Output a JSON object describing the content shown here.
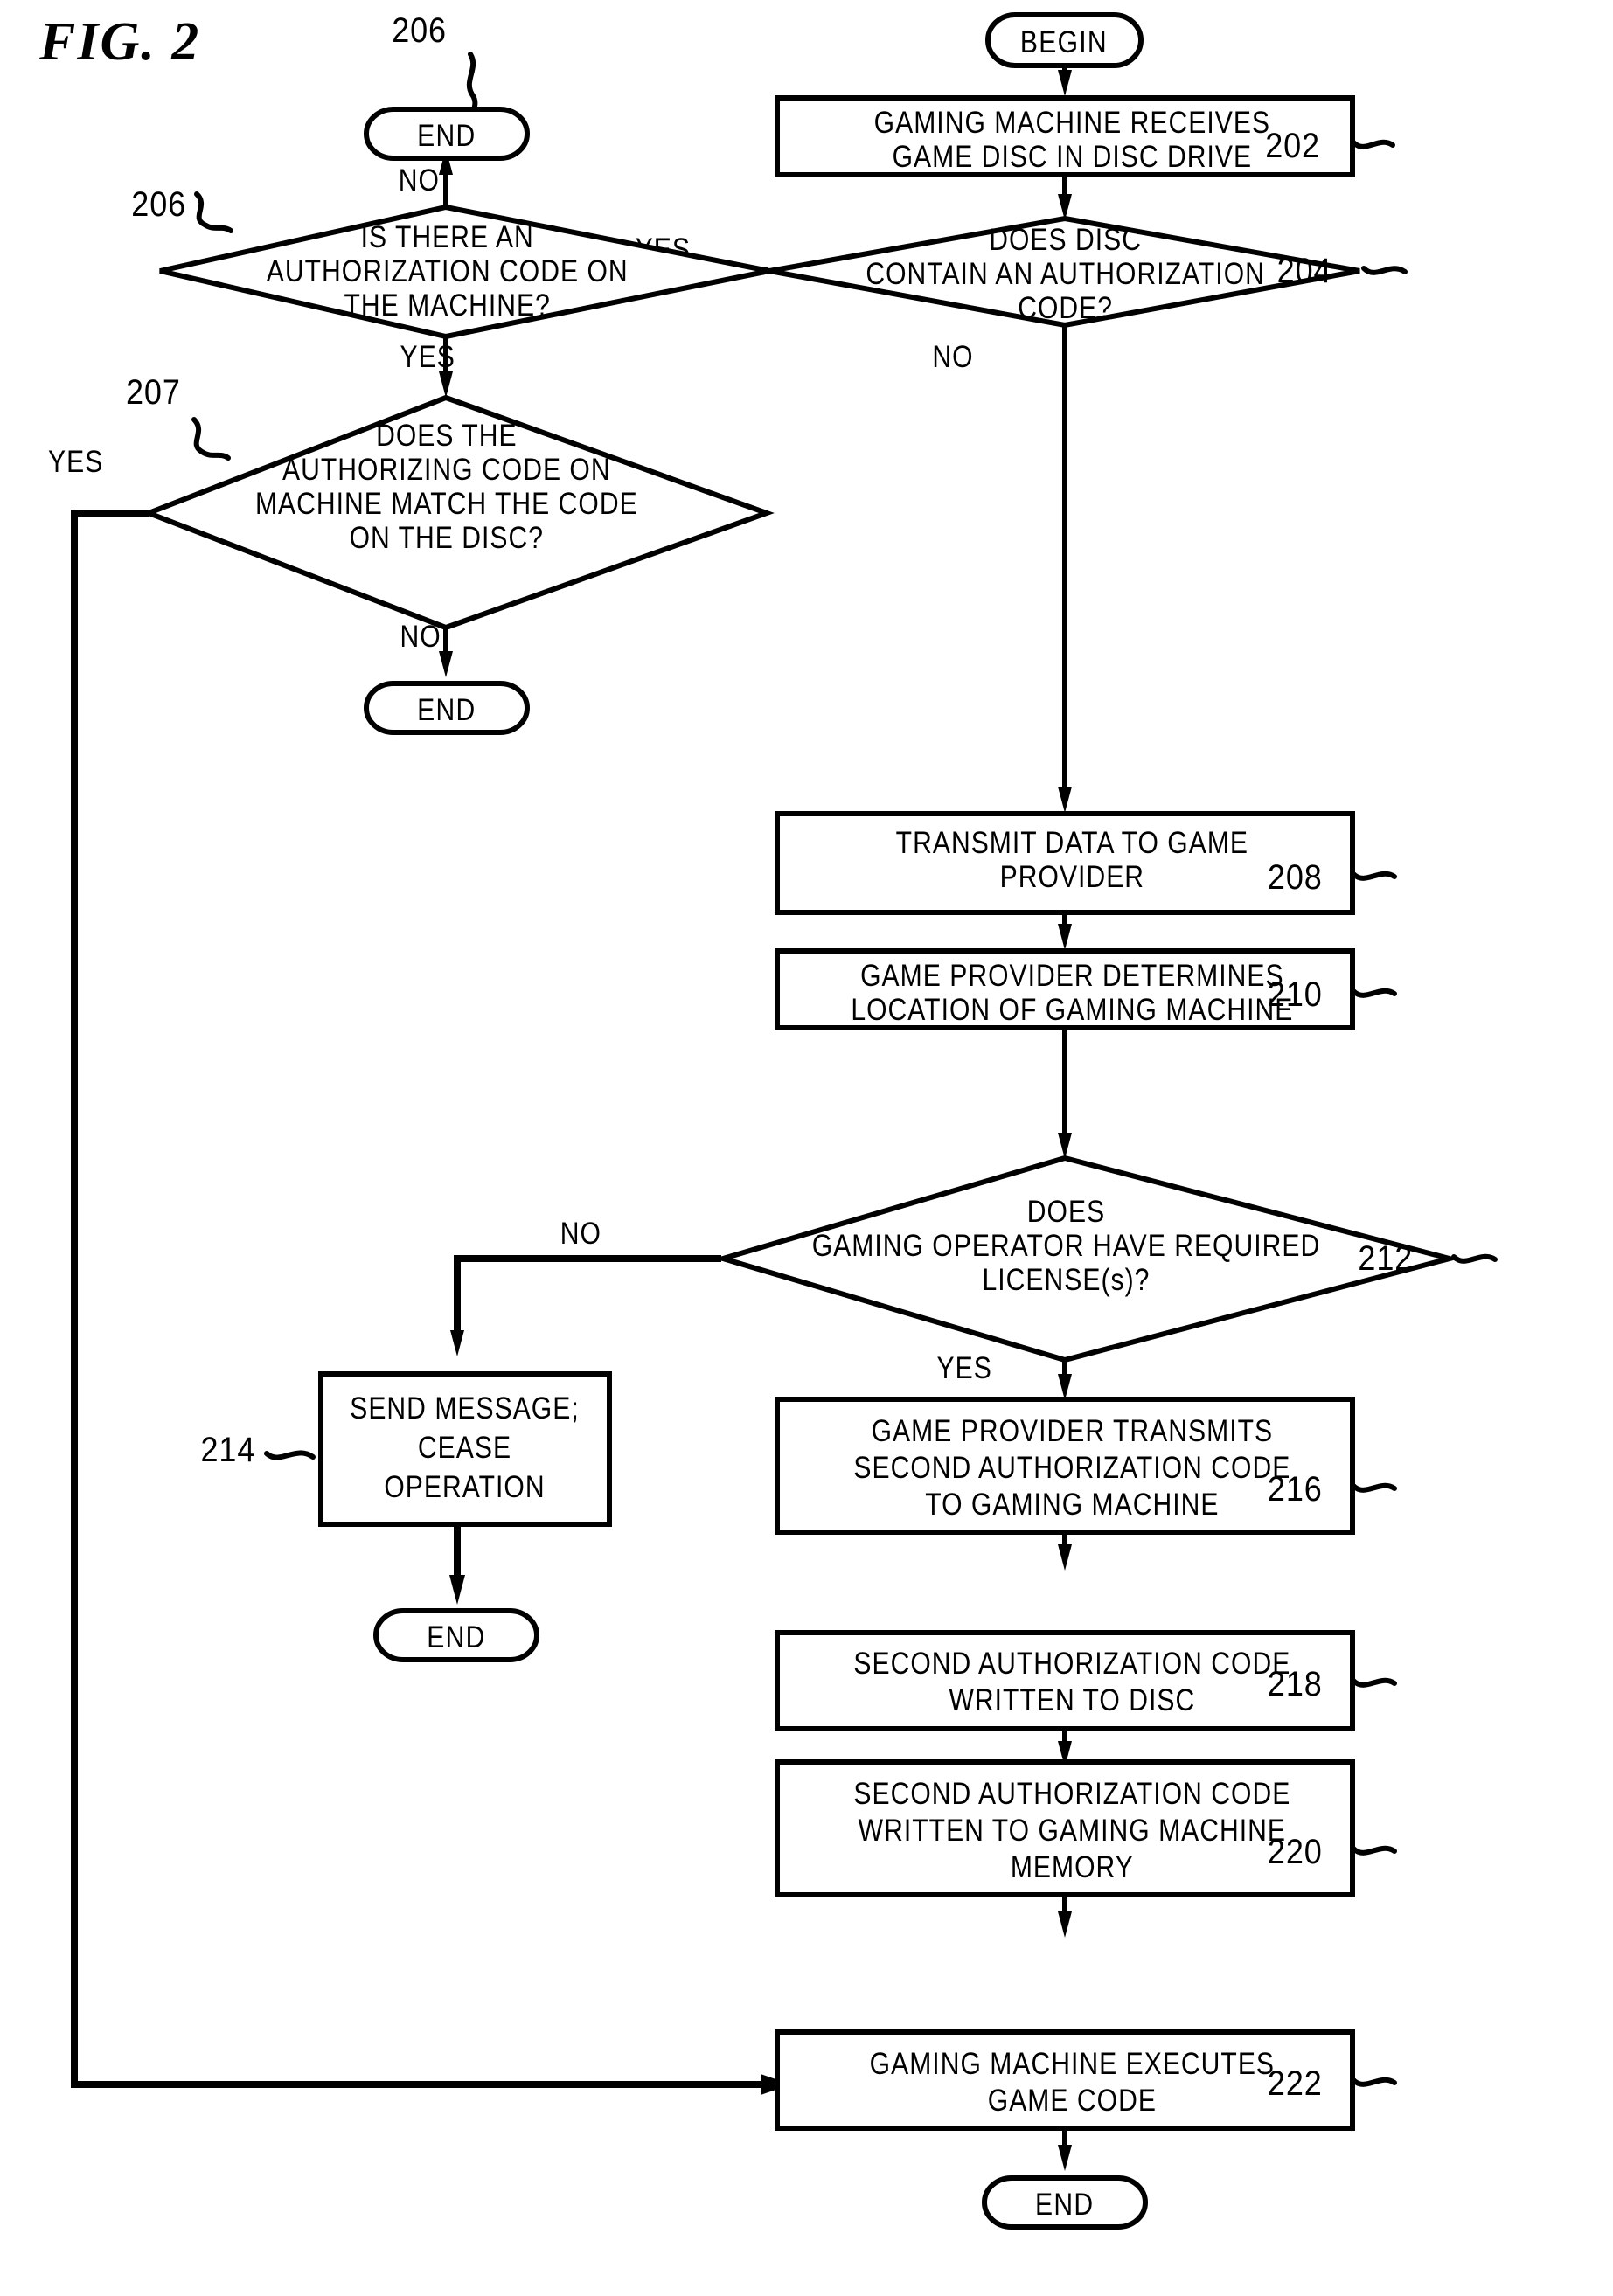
{
  "figure": {
    "title": "FIG. 2",
    "overall_ref": "206"
  },
  "terminators": {
    "begin": "BEGIN",
    "end_top_left": "END",
    "end_mid_left": "END",
    "end_lower_left": "END",
    "end_bottom": "END"
  },
  "nodes": [
    {
      "ref": "202",
      "kind": "process",
      "lines": [
        "GAMING MACHINE RECEIVES",
        "GAME DISC IN DISC DRIVE"
      ]
    },
    {
      "ref": "204",
      "kind": "decision",
      "lines": [
        "DOES DISC",
        "CONTAIN AN AUTHORIZATION",
        "CODE?"
      ]
    },
    {
      "ref": "206",
      "kind": "decision",
      "lines": [
        "IS THERE AN",
        "AUTHORIZATION CODE ON",
        "THE MACHINE?"
      ]
    },
    {
      "ref": "207",
      "kind": "decision",
      "lines": [
        "DOES THE",
        "AUTHORIZING CODE ON",
        "MACHINE MATCH THE CODE",
        "ON THE DISC?"
      ]
    },
    {
      "ref": "208",
      "kind": "process",
      "lines": [
        "TRANSMIT DATA TO GAME",
        "PROVIDER"
      ]
    },
    {
      "ref": "210",
      "kind": "process",
      "lines": [
        "GAME PROVIDER DETERMINES",
        "LOCATION OF GAMING MACHINE"
      ]
    },
    {
      "ref": "212",
      "kind": "decision",
      "lines": [
        "DOES",
        "GAMING OPERATOR HAVE REQUIRED",
        "LICENSE(s)?"
      ]
    },
    {
      "ref": "214",
      "kind": "process",
      "lines": [
        "SEND MESSAGE;",
        "CEASE",
        "OPERATION"
      ]
    },
    {
      "ref": "216",
      "kind": "process",
      "lines": [
        "GAME PROVIDER TRANSMITS",
        "SECOND AUTHORIZATION CODE",
        "TO GAMING MACHINE"
      ]
    },
    {
      "ref": "218",
      "kind": "process",
      "lines": [
        "SECOND AUTHORIZATION CODE",
        "WRITTEN TO DISC"
      ]
    },
    {
      "ref": "220",
      "kind": "process",
      "lines": [
        "SECOND AUTHORIZATION CODE",
        "WRITTEN TO GAMING MACHINE",
        "MEMORY"
      ]
    },
    {
      "ref": "222",
      "kind": "process",
      "lines": [
        "GAMING MACHINE EXECUTES",
        "GAME CODE"
      ]
    }
  ],
  "edge_labels": {
    "d204_yes": "YES",
    "d204_no": "NO",
    "d206_no": "NO",
    "d206_yes": "YES",
    "d207_yes": "YES",
    "d207_no": "NO",
    "d212_no": "NO",
    "d212_yes": "YES"
  }
}
